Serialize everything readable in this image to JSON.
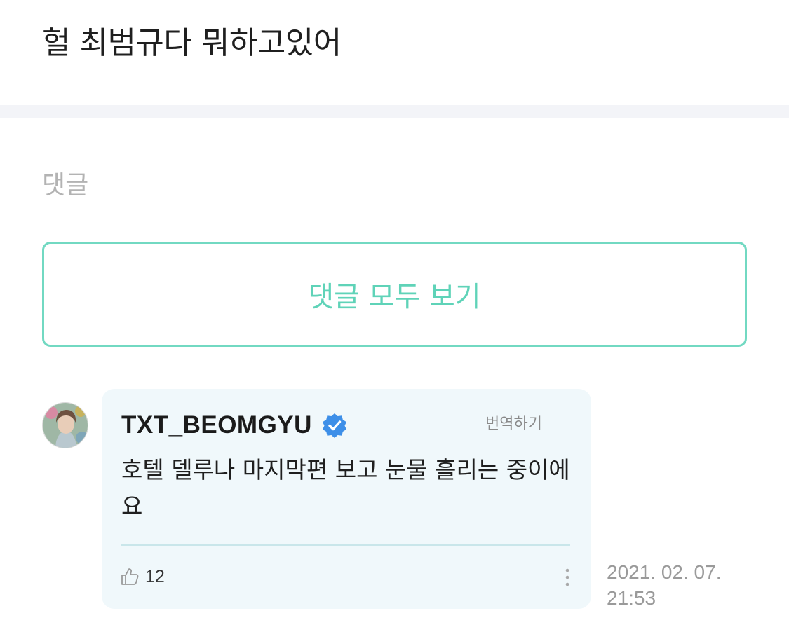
{
  "post": {
    "text": "헐 최범규다 뭐하고있어"
  },
  "comments_section": {
    "heading": "댓글",
    "view_all_label": "댓글 모두 보기"
  },
  "comment": {
    "author": "TXT_BEOMGYU",
    "translate_label": "번역하기",
    "body": "호텔 델루나 마지막편 보고 눈물 흘리는 중이에요",
    "likes": "12",
    "date": "2021. 02. 07.",
    "time": "21:53",
    "icons": {
      "verified": "verified-badge-icon",
      "like": "thumbs-up-icon",
      "more": "more-vertical-icon"
    }
  },
  "colors": {
    "accent": "#5fd3b8",
    "accent_border": "#72d9c2",
    "card_background": "#f0f8fb",
    "verified_blue": "#3d8fe8"
  }
}
